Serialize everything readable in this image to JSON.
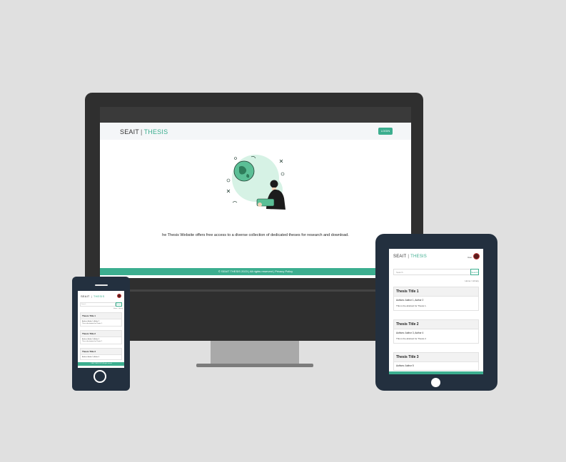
{
  "brand": {
    "part1": "SEAIT",
    "separator": "|",
    "part2": "THESIS"
  },
  "desktop": {
    "login_label": "LOGIN",
    "tagline": "he Thesis Website offers free access to a diverse collection of dedicated theses for research and download.",
    "footer": "© SEAIT THESIS 2023 | All rights reserved | Privacy Policy"
  },
  "tablet": {
    "user_label": "User",
    "search_placeholder": "Search",
    "search_button": "Search",
    "breadcrumb": "Home / Library",
    "theses": [
      {
        "title": "Thesis Title 1",
        "authors": "Authors: Author 1, Author 2",
        "abstract": "This is the abstract for Thesis 1."
      },
      {
        "title": "Thesis Title 2",
        "authors": "Authors: Author 3, Author 4",
        "abstract": "This is the abstract for Thesis 2."
      },
      {
        "title": "Thesis Title 3",
        "authors": "Authors: Author 5"
      }
    ]
  },
  "phone": {
    "search_placeholder": "Search",
    "search_button": "Search",
    "breadcrumb": "Home / Library",
    "theses": [
      {
        "title": "Thesis Title 1",
        "authors": "Authors: Author 1, Author 2",
        "abstract": "This is the abstract for Thesis 1."
      },
      {
        "title": "Thesis Title 2",
        "authors": "Authors: Author 3, Author 4",
        "abstract": "This is the abstract for Thesis 2."
      },
      {
        "title": "Thesis Title 3",
        "authors": "Authors: Author 5, Author 6"
      }
    ],
    "footer": "© SEAIT THESIS 2023 | All rights reserved"
  },
  "colors": {
    "accent": "#3cae8f",
    "device_dark": "#23303f",
    "monitor": "#2f2f2f",
    "background": "#e0e0e0"
  },
  "icons": {
    "avatar": "user-avatar-icon",
    "home_button": "home-button-icon",
    "illustration": "person-reading-globe-illustration"
  }
}
